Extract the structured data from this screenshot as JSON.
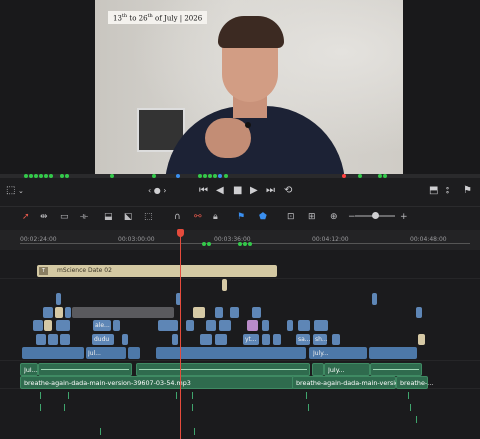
{
  "viewer": {
    "caption": "13th to 26th of July | 2026"
  },
  "colors": {
    "marker_green": "#33c94a",
    "marker_blue": "#3a8ff0",
    "marker_red": "#ff4040",
    "playhead": "#e54b3c",
    "video_clip": "#5e86b6",
    "title_clip": "#d4c9a3",
    "audio_clip": "#2f6b4e"
  },
  "transport": {
    "icons": [
      "viewer-options-icon",
      "prev-frame-icon",
      "skip-start-icon",
      "play-reverse-icon",
      "stop-icon",
      "play-icon",
      "skip-end-icon",
      "loop-icon",
      "fullscreen-icon",
      "mark-icon",
      "flag-icon"
    ]
  },
  "toolbar": {
    "icons": [
      "selection-tool-icon",
      "trim-tool-icon",
      "dynamic-trim-icon",
      "blade-tool-icon",
      "insert-icon",
      "overwrite-icon",
      "replace-icon",
      "snapping-icon",
      "linked-selection-icon",
      "lock-icon",
      "flag-icon",
      "marker-icon",
      "zoom-fit-icon",
      "zoom-detail-icon",
      "zoom-custom-icon",
      "zoom-out-icon",
      "zoom-in-icon"
    ]
  },
  "ruler": {
    "ticks": [
      "00:02:24:00",
      "00:03:00:00",
      "00:03:36:00",
      "00:04:12:00",
      "00:04:48:00"
    ]
  },
  "timeline": {
    "title_clip": "mScience Date 02",
    "video_labels": [
      "ale...",
      "dudu",
      "Jul...",
      "yt...",
      "sa...",
      "sh...",
      "July..."
    ],
    "audio_labels_row1": [
      "Jul...",
      "July..."
    ],
    "audio_labels_row2": [
      "breathe-again-dada-main-version-39607-03-54.mp3",
      "breathe-again-dada-main-version-39...",
      "breathe-..."
    ]
  }
}
